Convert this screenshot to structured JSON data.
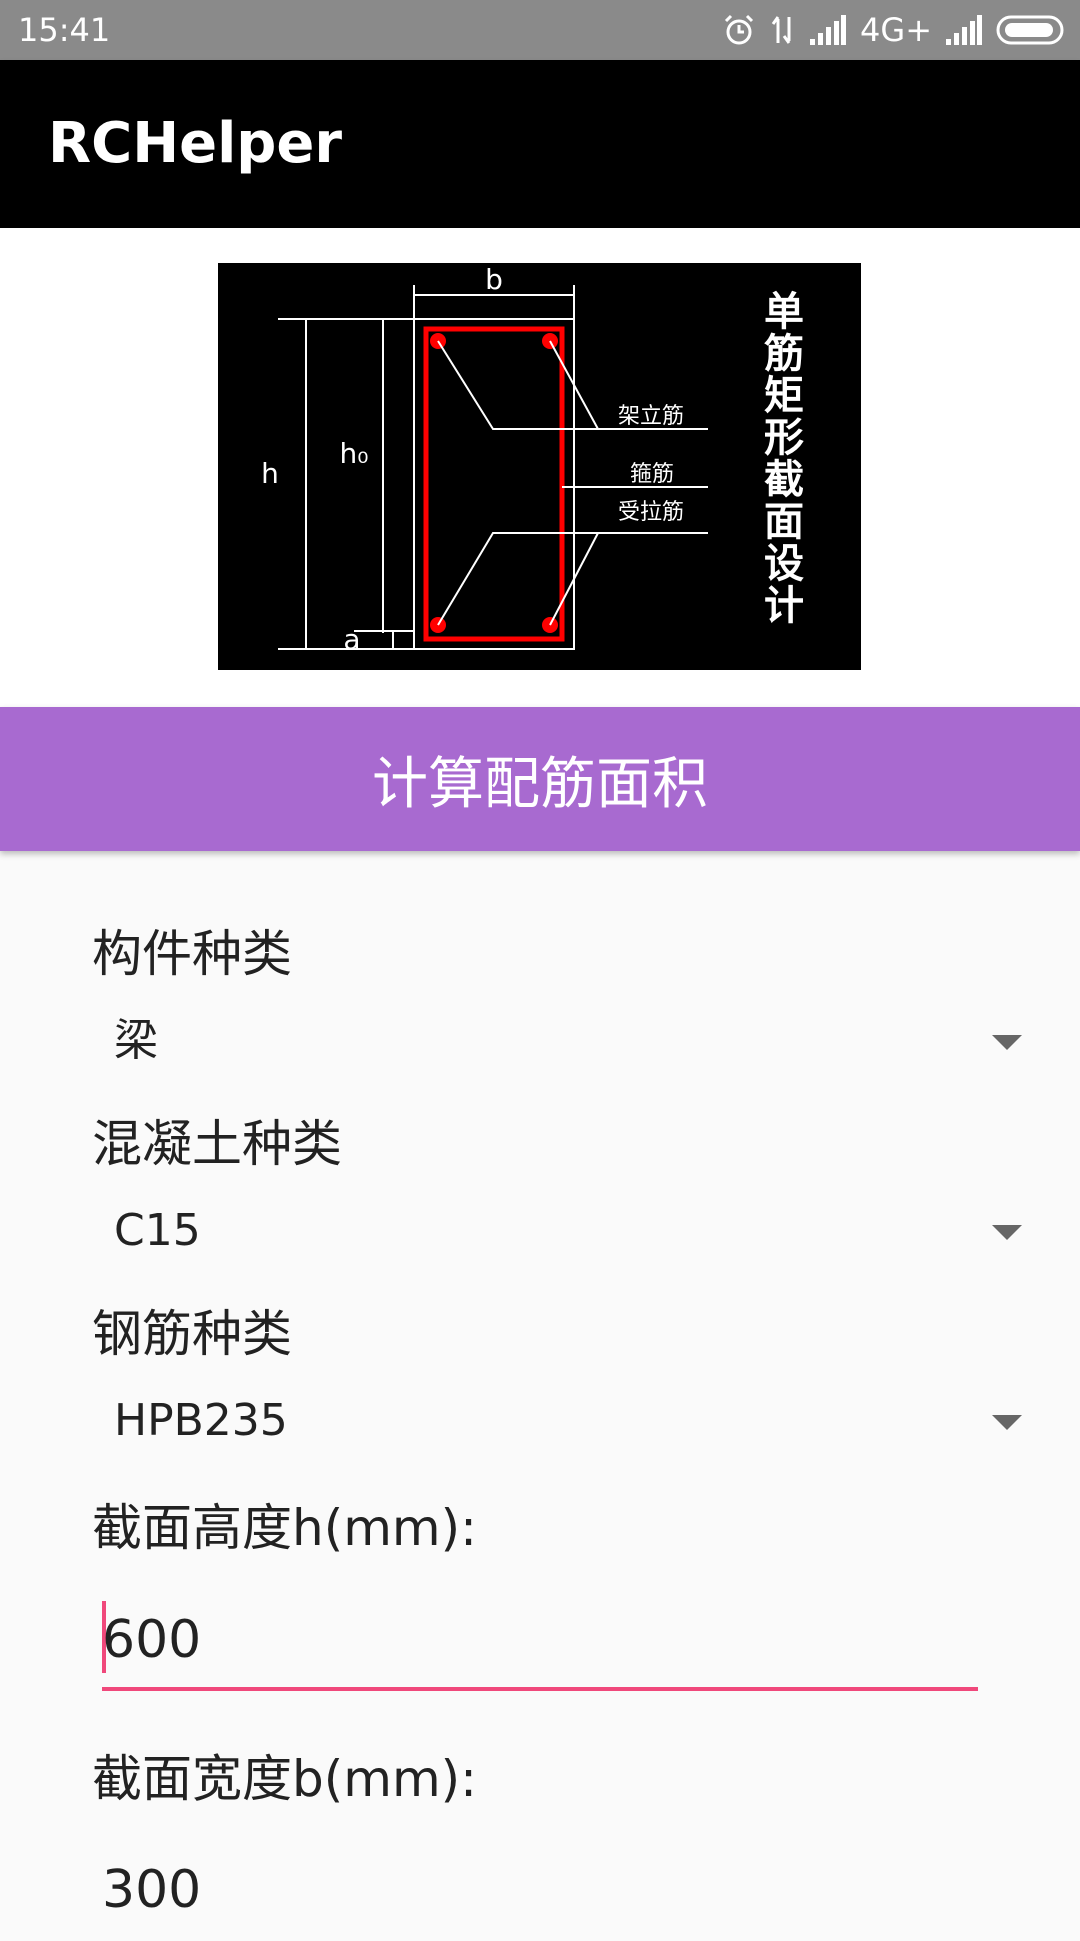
{
  "status_bar": {
    "time": "15:41",
    "network": "4G+",
    "icons": [
      "alarm-icon",
      "data-transfer-icon",
      "signal-icon",
      "signal-icon",
      "battery-icon"
    ]
  },
  "app_bar": {
    "title": "RCHelper"
  },
  "diagram": {
    "dim_b": "b",
    "dim_h": "h",
    "dim_h0": "h₀",
    "dim_a": "a",
    "label_erection_bar": "架立筋",
    "label_stirrup": "箍筋",
    "label_tension_bar": "受拉筋",
    "side_title": [
      "单",
      "筋",
      "矩",
      "形",
      "截",
      "面",
      "设",
      "计"
    ],
    "colors": {
      "rebar": "#ff0000",
      "lines": "#ffffff",
      "background": "#000000"
    }
  },
  "calc_button": {
    "label": "计算配筋面积",
    "color": "#a86ad0"
  },
  "form": {
    "member_type": {
      "label": "构件种类",
      "value": "梁"
    },
    "concrete_type": {
      "label": "混凝土种类",
      "value": "C15"
    },
    "steel_type": {
      "label": "钢筋种类",
      "value": "HPB235"
    },
    "section_height": {
      "label": "截面高度h(mm):",
      "value": "600"
    },
    "section_width": {
      "label": "截面宽度b(mm):",
      "value": "300"
    },
    "accent_color": "#f0487b"
  }
}
